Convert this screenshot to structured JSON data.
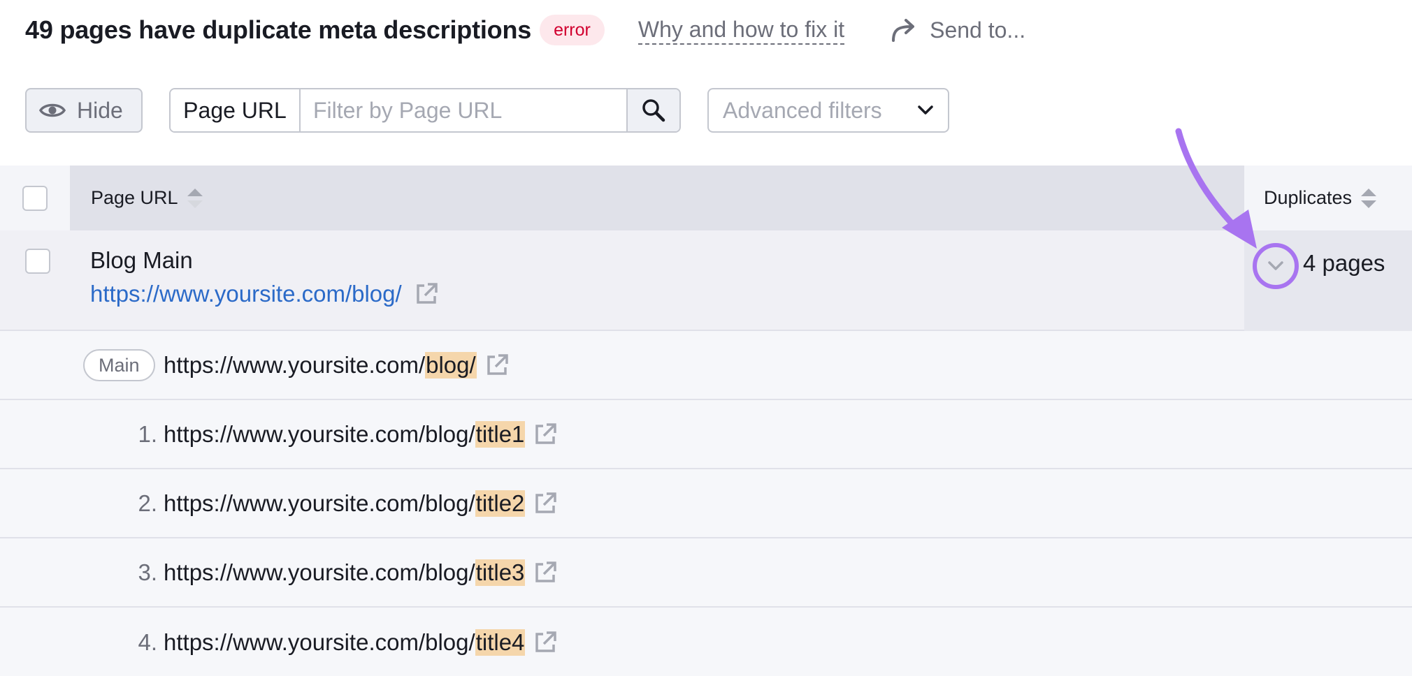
{
  "header": {
    "title": "49 pages have duplicate meta descriptions",
    "badge": "error",
    "why_link": "Why and how to fix it",
    "send_to": "Send to..."
  },
  "toolbar": {
    "hide_label": "Hide",
    "url_select_label": "Page URL",
    "url_placeholder": "Filter by Page URL",
    "advanced_filters": "Advanced filters"
  },
  "table": {
    "col_url": "Page URL",
    "col_duplicates": "Duplicates",
    "main_row": {
      "name": "Blog Main",
      "url": "https://www.yoursite.com/blog/",
      "duplicates": "4 pages"
    },
    "main_tag": "Main",
    "main_sub": {
      "prefix": "https://www.yoursite.com/",
      "highlight": "blog/"
    },
    "sub_rows": [
      {
        "index": "1.",
        "prefix": "https://www.yoursite.com/blog/",
        "highlight": "title1"
      },
      {
        "index": "2.",
        "prefix": "https://www.yoursite.com/blog/",
        "highlight": "title2"
      },
      {
        "index": "3.",
        "prefix": "https://www.yoursite.com/blog/",
        "highlight": "title3"
      },
      {
        "index": "4.",
        "prefix": "https://www.yoursite.com/blog/",
        "highlight": "title4"
      }
    ]
  },
  "colors": {
    "error_red": "#d1002f",
    "link_blue": "#2b6ac8",
    "highlight": "#f5d6ab",
    "annotation_purple": "#a874f0"
  },
  "icons": [
    "send-arrow-icon",
    "eye-icon",
    "search-icon",
    "chevron-down-icon",
    "sort-icon",
    "external-link-icon"
  ]
}
